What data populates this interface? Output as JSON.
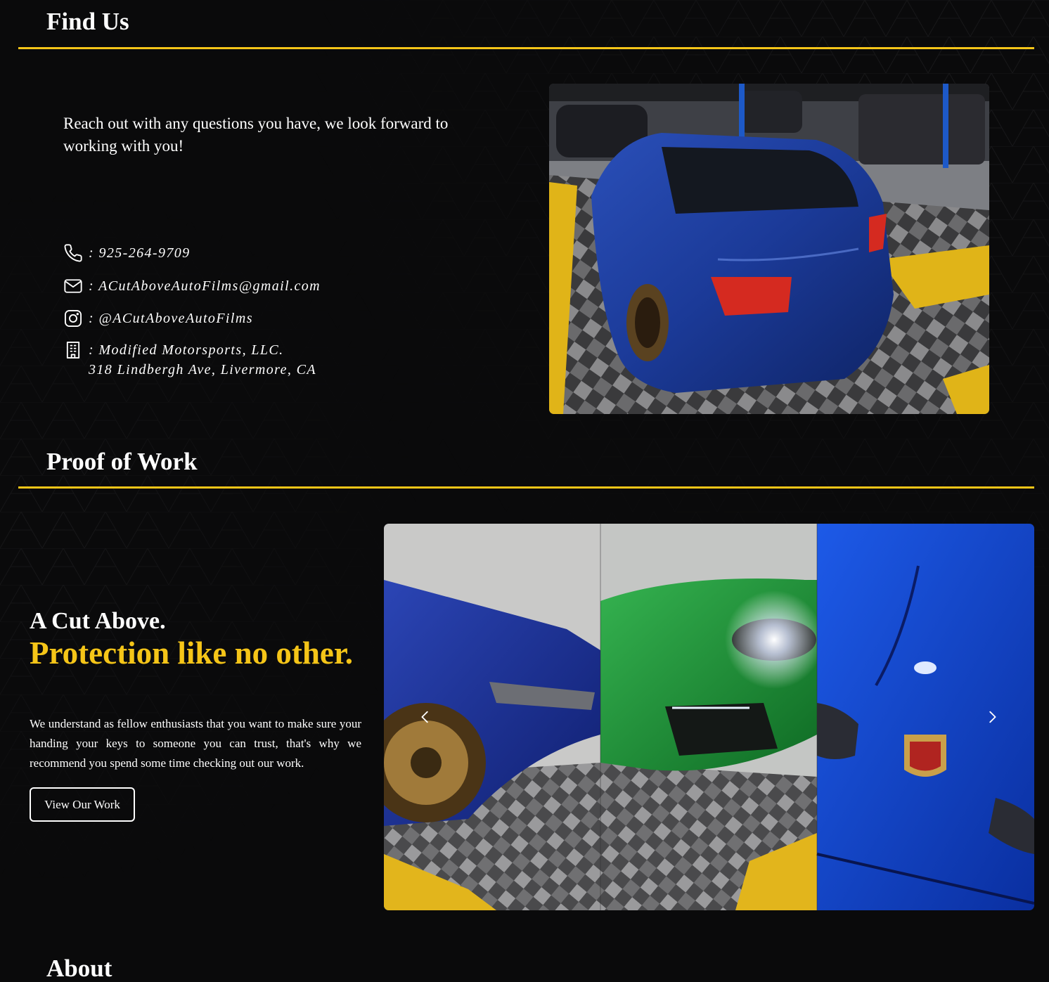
{
  "find_us": {
    "title": "Find Us",
    "intro": "Reach out with any questions you have, we look forward to working with you!",
    "phone": ": 925-264-9709",
    "email": ": ACutAboveAutoFilms@gmail.com",
    "instagram": ": @ACutAboveAutoFilms",
    "address_line1": ": Modified Motorsports, LLC.",
    "address_line2": "318 Lindbergh Ave, Livermore, CA",
    "icons": [
      "phone-icon",
      "mail-icon",
      "instagram-icon",
      "building-icon"
    ]
  },
  "proof_of_work": {
    "title": "Proof of Work",
    "heading_white": "A Cut Above.",
    "heading_gold": "Protection like no other.",
    "body": "We understand as fellow enthusiasts that you want to make sure your handing your keys to someone you can trust, that's why we recommend you spend some time checking out our work.",
    "button_label": "View Our Work"
  },
  "about": {
    "title": "About"
  },
  "colors": {
    "background": "#0a0a0b",
    "accent_gold": "#f5c518",
    "text": "#ffffff"
  }
}
